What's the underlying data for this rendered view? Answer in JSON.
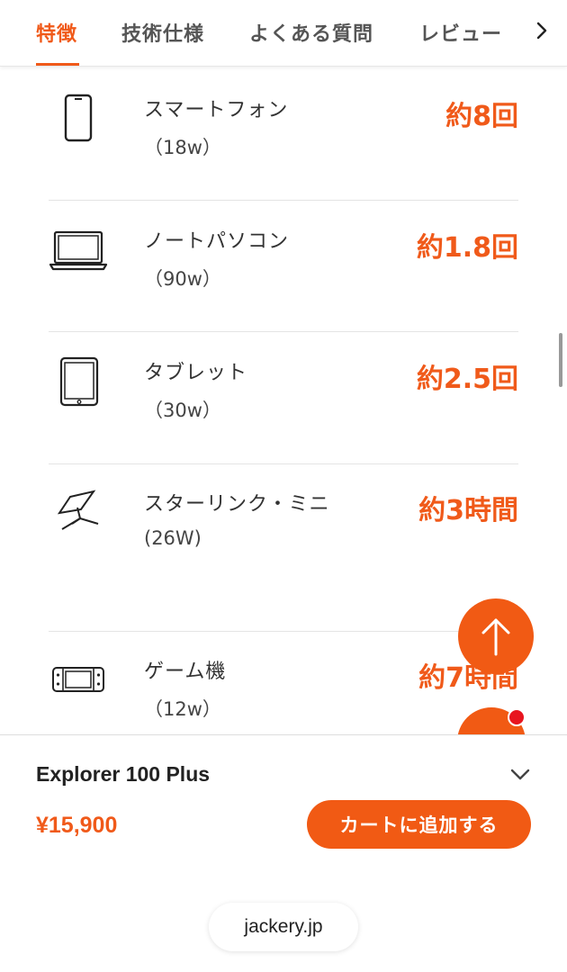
{
  "tabs": [
    {
      "label": "特徴",
      "active": true
    },
    {
      "label": "技術仕様"
    },
    {
      "label": "よくある質問"
    },
    {
      "label": "レビュー"
    }
  ],
  "devices": [
    {
      "icon": "smartphone-icon",
      "name": "スマートフォン",
      "watt": "（18w）",
      "value": "約8回"
    },
    {
      "icon": "laptop-icon",
      "name": "ノートパソコン",
      "watt": "（90w）",
      "value": "約1.8回"
    },
    {
      "icon": "tablet-icon",
      "name": "タブレット",
      "watt": "（30w）",
      "value": "約2.5回"
    },
    {
      "icon": "satellite-dish-icon",
      "name": "スターリンク・ミニ",
      "watt": "(26W)",
      "value": "約3時間"
    },
    {
      "icon": "game-console-icon",
      "name": "ゲーム機",
      "watt": "（12w）",
      "value": "約7時間"
    }
  ],
  "product": {
    "name": "Explorer 100 Plus",
    "price": "¥15,900",
    "cart_label": "カートに追加する"
  },
  "browser": {
    "url": "jackery.jp"
  },
  "colors": {
    "accent": "#f05a1a",
    "badge": "#e8151f"
  }
}
